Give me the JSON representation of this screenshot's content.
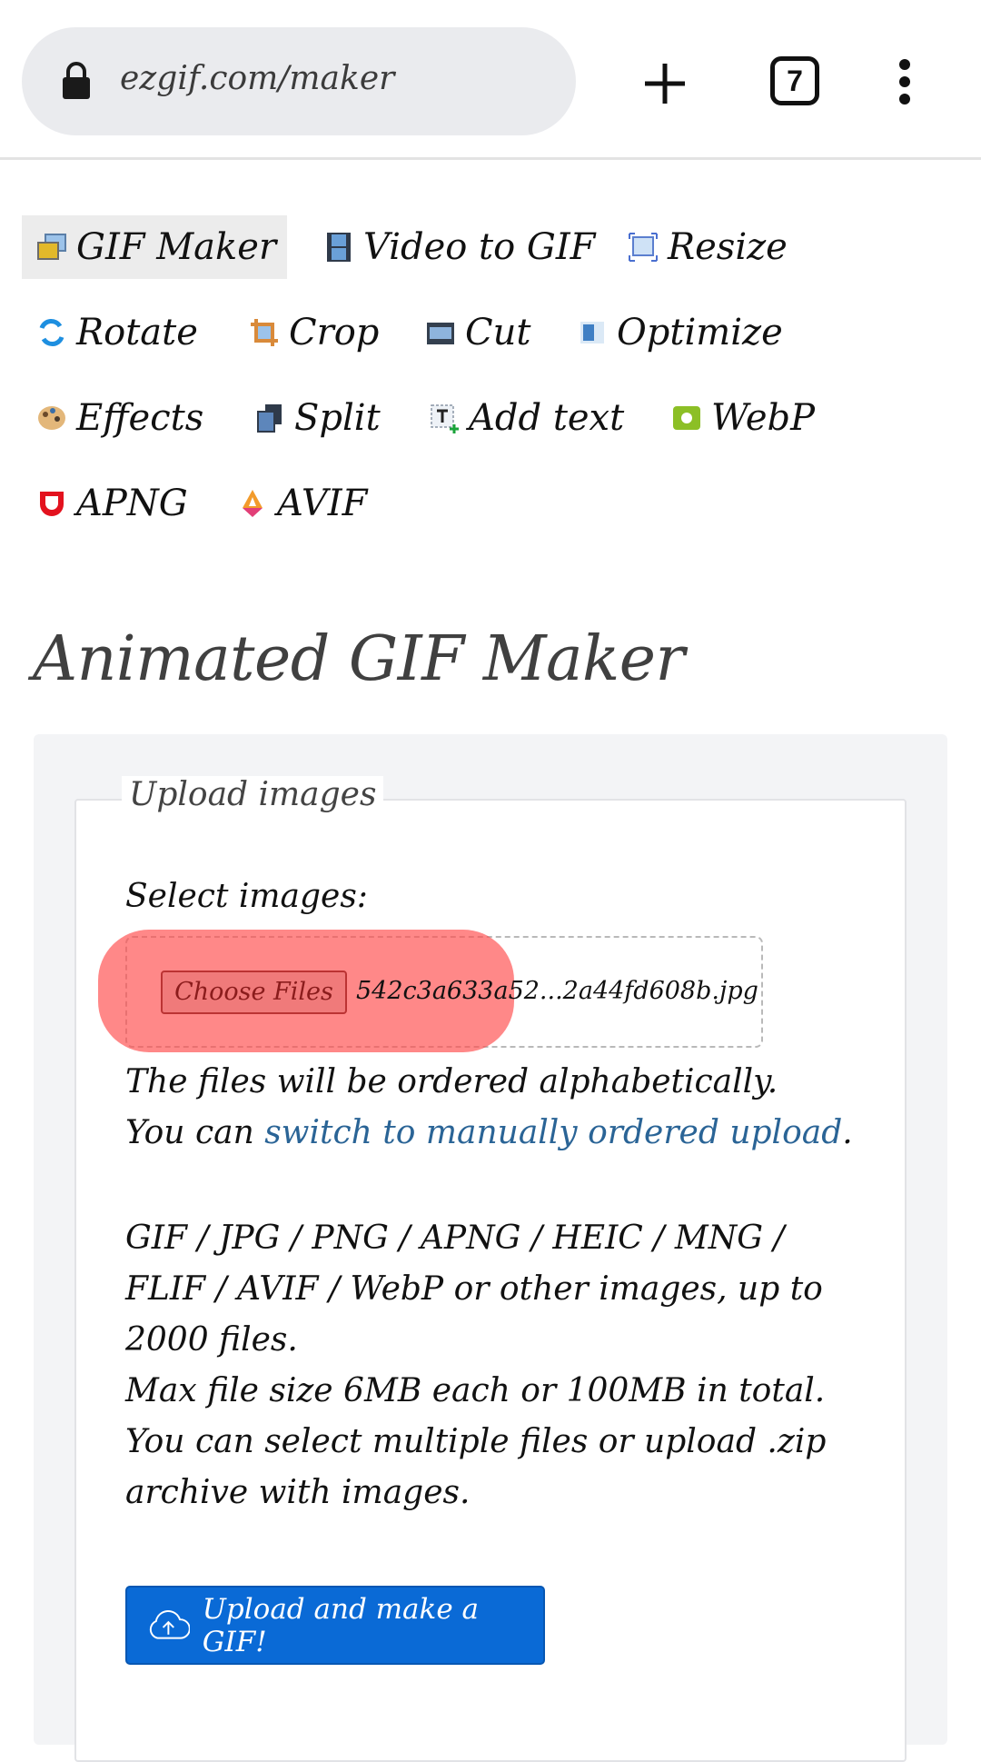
{
  "browser": {
    "url": "ezgif.com/maker",
    "tab_count": "7",
    "icons": {
      "lock": "lock-icon",
      "new_tab": "plus-icon",
      "tabs": "tab-switcher-icon",
      "menu": "more-vert-icon"
    }
  },
  "nav": {
    "items": [
      {
        "label": "GIF Maker",
        "icon": "gif-maker-icon",
        "active": true
      },
      {
        "label": "Video to GIF",
        "icon": "film-strip-icon",
        "active": false
      },
      {
        "label": "Resize",
        "icon": "resize-icon",
        "active": false
      },
      {
        "label": "Rotate",
        "icon": "rotate-icon",
        "active": false
      },
      {
        "label": "Crop",
        "icon": "crop-icon",
        "active": false
      },
      {
        "label": "Cut",
        "icon": "cut-icon",
        "active": false
      },
      {
        "label": "Optimize",
        "icon": "optimize-icon",
        "active": false
      },
      {
        "label": "Effects",
        "icon": "palette-icon",
        "active": false
      },
      {
        "label": "Split",
        "icon": "split-icon",
        "active": false
      },
      {
        "label": "Add text",
        "icon": "add-text-icon",
        "active": false
      },
      {
        "label": "WebP",
        "icon": "webp-icon",
        "active": false
      },
      {
        "label": "APNG",
        "icon": "apng-icon",
        "active": false
      },
      {
        "label": "AVIF",
        "icon": "avif-icon",
        "active": false
      }
    ]
  },
  "main": {
    "title": "Animated GIF Maker",
    "form": {
      "legend": "Upload images",
      "select_label": "Select images:",
      "choose_files_label": "Choose Files",
      "selected_file": "542c3a633a52...2a44fd608b.jpg",
      "order_note": "The files will be ordered alphabetically.",
      "switch_prefix": "You can ",
      "switch_link": "switch to manually ordered upload",
      "switch_suffix": ".",
      "info_lines": [
        "GIF / JPG / PNG / APNG / HEIC / MNG /",
        "FLIF / AVIF / WebP or other images, up to",
        "2000 files.",
        "Max file size 6MB each or 100MB in total.",
        "You can select multiple files or upload .zip",
        "archive with images."
      ],
      "submit_label": "Upload and make a GIF!"
    }
  },
  "colors": {
    "link": "#2a6496",
    "primary_button": "#0a6ad6",
    "highlight": "#ff5050"
  }
}
